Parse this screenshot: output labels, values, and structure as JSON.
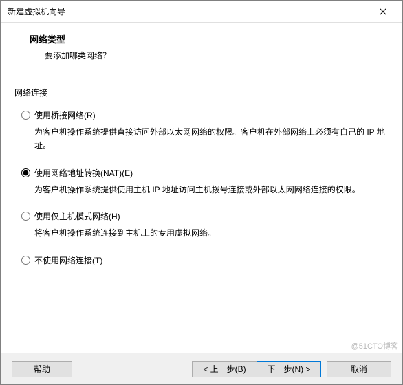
{
  "title": "新建虚拟机向导",
  "header": {
    "title": "网络类型",
    "subtitle": "要添加哪类网络？"
  },
  "section_label": "网络连接",
  "options": [
    {
      "label": "使用桥接网络(R)",
      "desc": "为客户机操作系统提供直接访问外部以太网网络的权限。客户机在外部网络上必须有自己的 IP 地址。",
      "selected": false
    },
    {
      "label": "使用网络地址转换(NAT)(E)",
      "desc": "为客户机操作系统提供使用主机 IP 地址访问主机拨号连接或外部以太网网络连接的权限。",
      "selected": true
    },
    {
      "label": "使用仅主机模式网络(H)",
      "desc": "将客户机操作系统连接到主机上的专用虚拟网络。",
      "selected": false
    },
    {
      "label": "不使用网络连接(T)",
      "desc": "",
      "selected": false
    }
  ],
  "buttons": {
    "help": "帮助",
    "back": "< 上一步(B)",
    "next": "下一步(N) >",
    "cancel": "取消"
  },
  "watermark": "@51CTO博客"
}
